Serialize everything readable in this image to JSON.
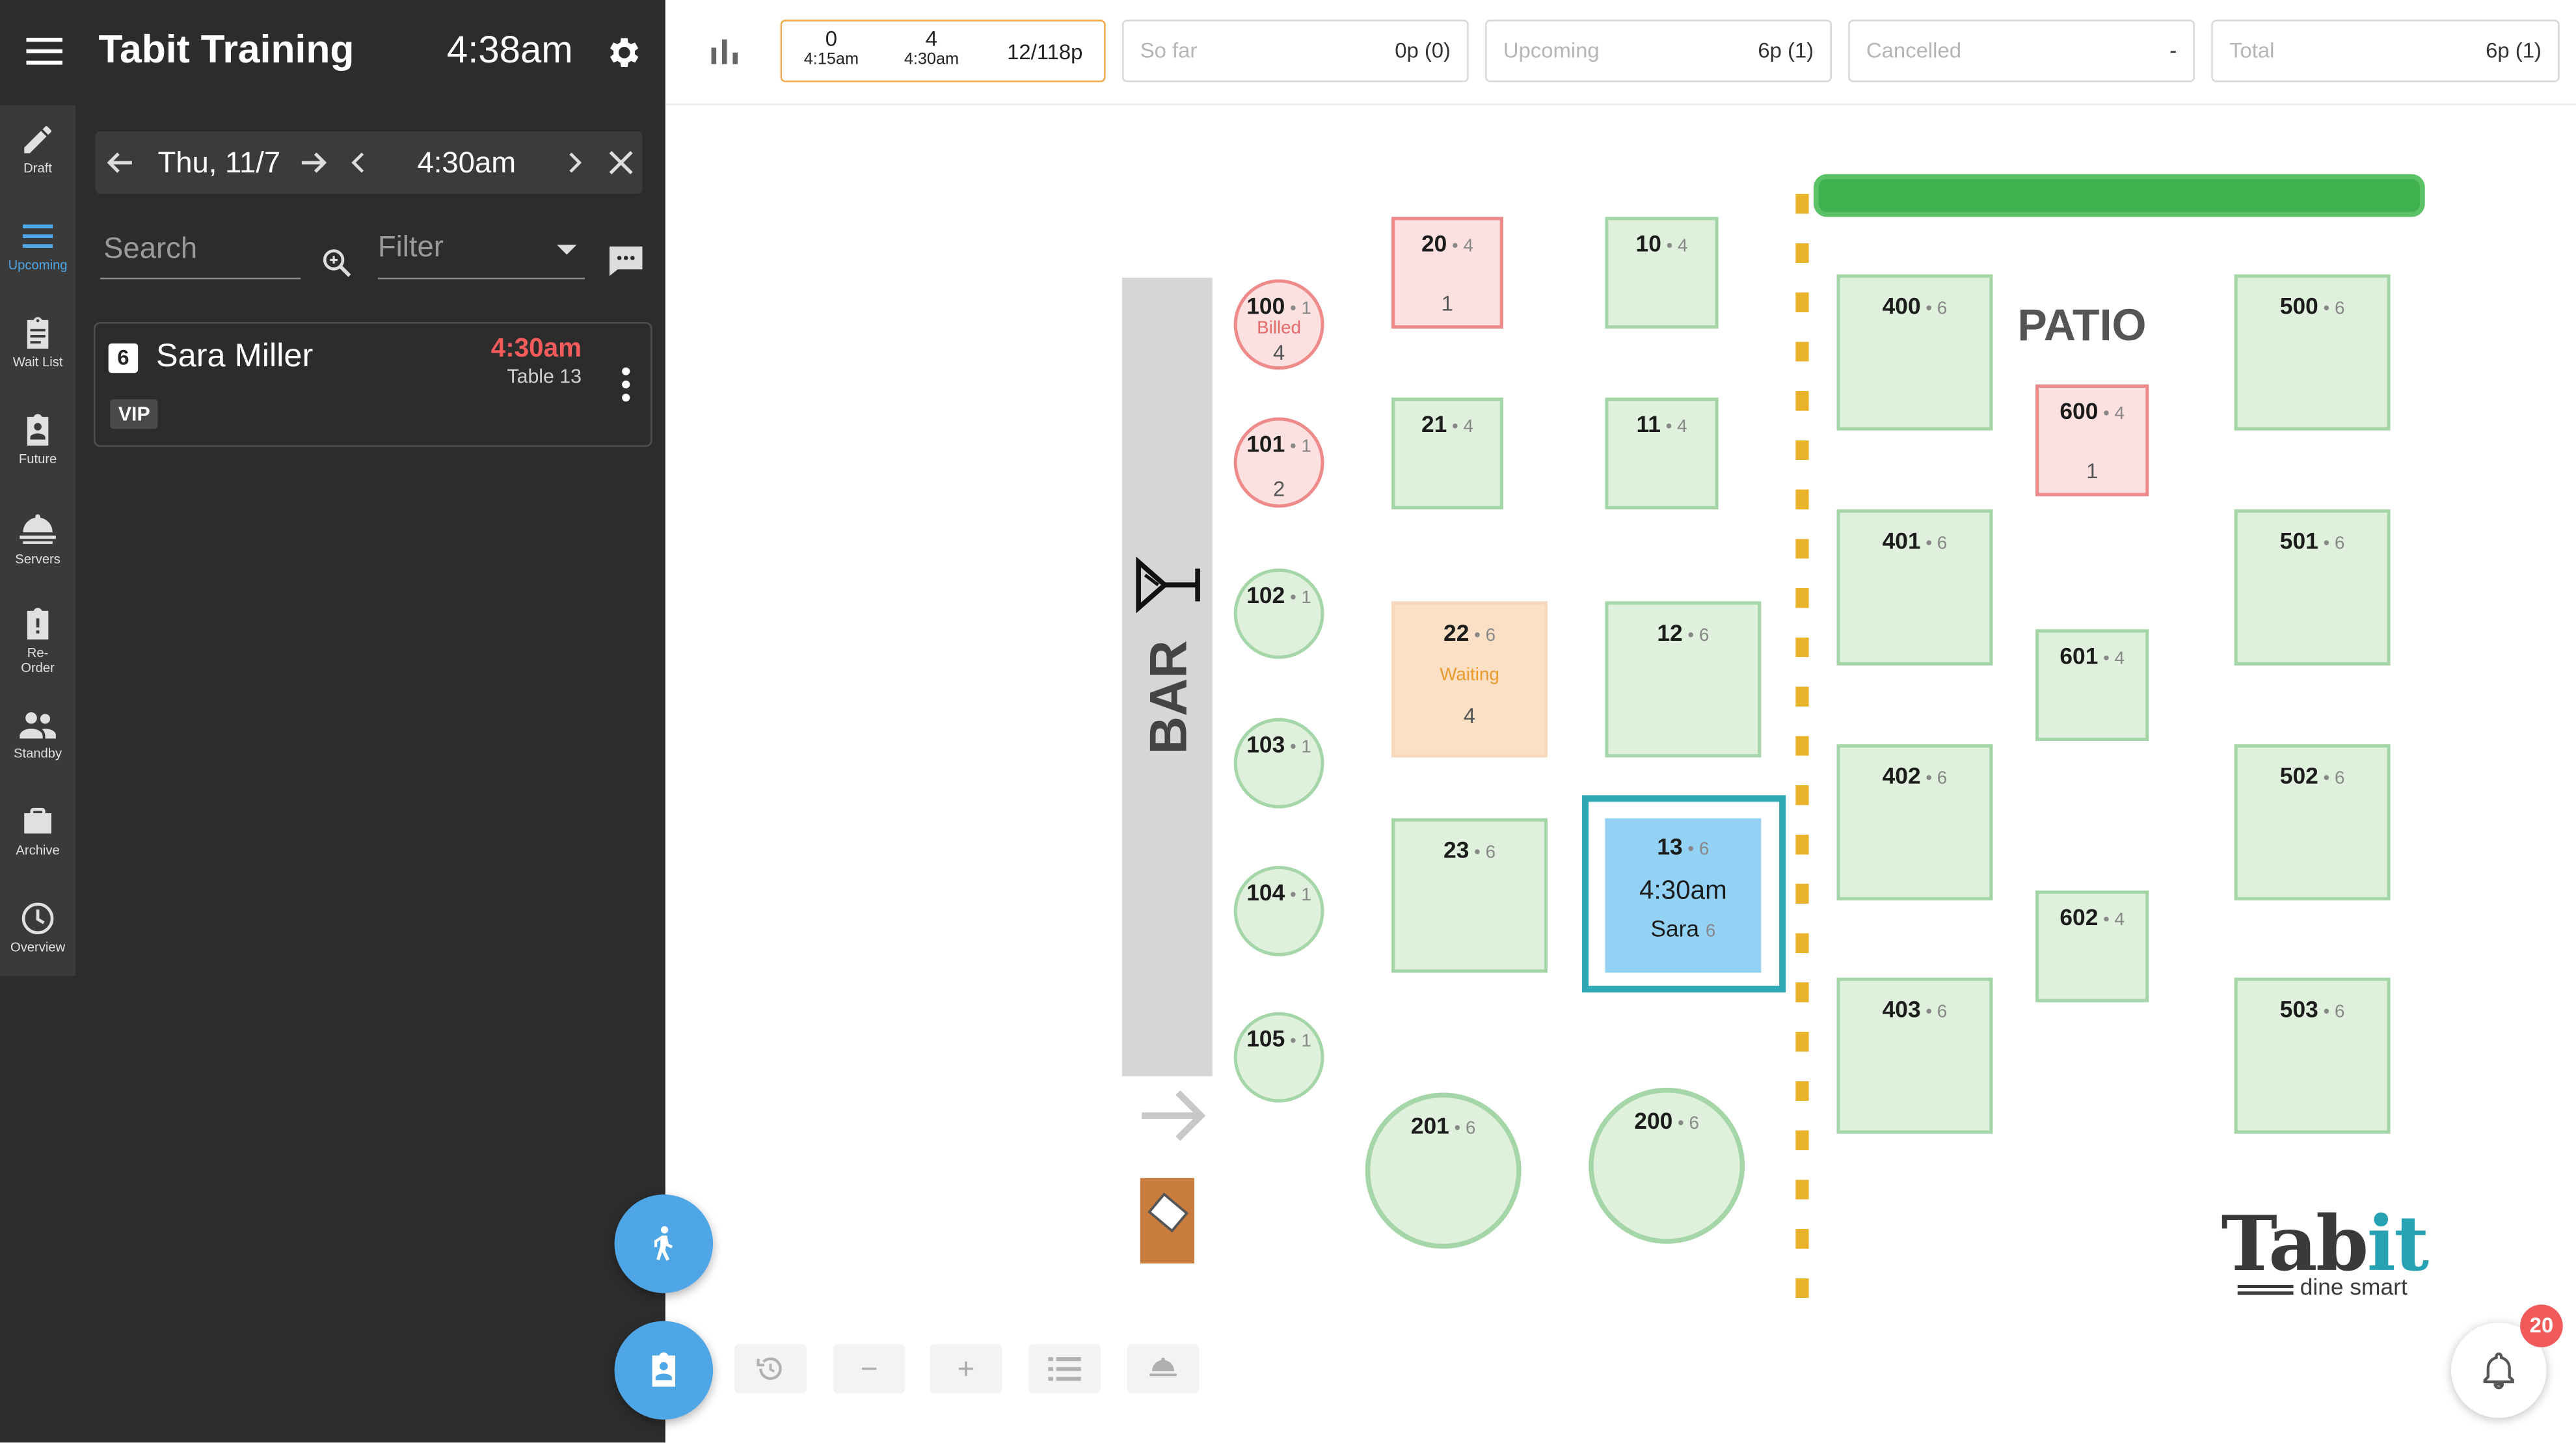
{
  "header": {
    "app_title": "Tabit Training",
    "clock": "4:38am"
  },
  "date_nav": {
    "date": "Thu, 11/7",
    "time": "4:30am"
  },
  "search": {
    "placeholder": "Search"
  },
  "filter": {
    "label": "Filter"
  },
  "nav": [
    {
      "label": "Draft",
      "icon": "pencil-icon"
    },
    {
      "label": "Upcoming",
      "icon": "list-icon"
    },
    {
      "label": "Wait List",
      "icon": "clipboard-icon"
    },
    {
      "label": "Future",
      "icon": "calendar-person-icon"
    },
    {
      "label": "Servers",
      "icon": "cloche-icon"
    },
    {
      "label": "Re-",
      "label2": "Order",
      "icon": "clipboard-alert-icon"
    },
    {
      "label": "Standby",
      "icon": "people-icon"
    },
    {
      "label": "Archive",
      "icon": "briefcase-icon"
    },
    {
      "label": "Overview",
      "icon": "clock-icon"
    }
  ],
  "reservation": {
    "party_size": "6",
    "name": "Sara Miller",
    "time": "4:30am",
    "table": "Table 13",
    "tag": "VIP"
  },
  "stats": {
    "slot1_count": "0",
    "slot1_time": "4:15am",
    "slot2_count": "4",
    "slot2_time": "4:30am",
    "capacity": "12/118p",
    "so_far_label": "So far",
    "so_far_value": "0p (0)",
    "upcoming_label": "Upcoming",
    "upcoming_value": "6p (1)",
    "cancelled_label": "Cancelled",
    "cancelled_value": "-",
    "total_label": "Total",
    "total_value": "6p (1)"
  },
  "floor": {
    "bar_label": "BAR",
    "patio_label": "PATIO",
    "tables": {
      "t100": {
        "num": "100",
        "cap": "1",
        "status": "Billed",
        "count": "4"
      },
      "t101": {
        "num": "101",
        "cap": "1",
        "count": "2"
      },
      "t102": {
        "num": "102",
        "cap": "1"
      },
      "t103": {
        "num": "103",
        "cap": "1"
      },
      "t104": {
        "num": "104",
        "cap": "1"
      },
      "t105": {
        "num": "105",
        "cap": "1"
      },
      "t20": {
        "num": "20",
        "cap": "4",
        "count": "1"
      },
      "t21": {
        "num": "21",
        "cap": "4"
      },
      "t22": {
        "num": "22",
        "cap": "6",
        "status": "Waiting",
        "count": "4"
      },
      "t23": {
        "num": "23",
        "cap": "6"
      },
      "t201": {
        "num": "201",
        "cap": "6"
      },
      "t10": {
        "num": "10",
        "cap": "4"
      },
      "t11": {
        "num": "11",
        "cap": "4"
      },
      "t12": {
        "num": "12",
        "cap": "6"
      },
      "t13": {
        "num": "13",
        "cap": "6",
        "time": "4:30am",
        "guest": "Sara",
        "guest_count": "6"
      },
      "t200": {
        "num": "200",
        "cap": "6"
      },
      "t400": {
        "num": "400",
        "cap": "6"
      },
      "t401": {
        "num": "401",
        "cap": "6"
      },
      "t402": {
        "num": "402",
        "cap": "6"
      },
      "t403": {
        "num": "403",
        "cap": "6"
      },
      "t600": {
        "num": "600",
        "cap": "4",
        "count": "1"
      },
      "t601": {
        "num": "601",
        "cap": "4"
      },
      "t602": {
        "num": "602",
        "cap": "4"
      },
      "t500": {
        "num": "500",
        "cap": "6"
      },
      "t501": {
        "num": "501",
        "cap": "6"
      },
      "t502": {
        "num": "502",
        "cap": "6"
      },
      "t503": {
        "num": "503",
        "cap": "6"
      }
    }
  },
  "toolbar": {
    "minus": "−",
    "plus": "+"
  },
  "notifications": {
    "count": "20"
  },
  "logo": {
    "word_a": "Tab",
    "word_b": "it",
    "tagline": "dine smart"
  },
  "colors": {
    "accent": "#4ea6e6",
    "panel": "#2c2c2c",
    "table_free": "#dff0dc",
    "table_billed": "#fde1e1",
    "table_waiting": "#fbe0c6",
    "table_selected": "#93d2f5",
    "alert": "#f45b5b"
  }
}
